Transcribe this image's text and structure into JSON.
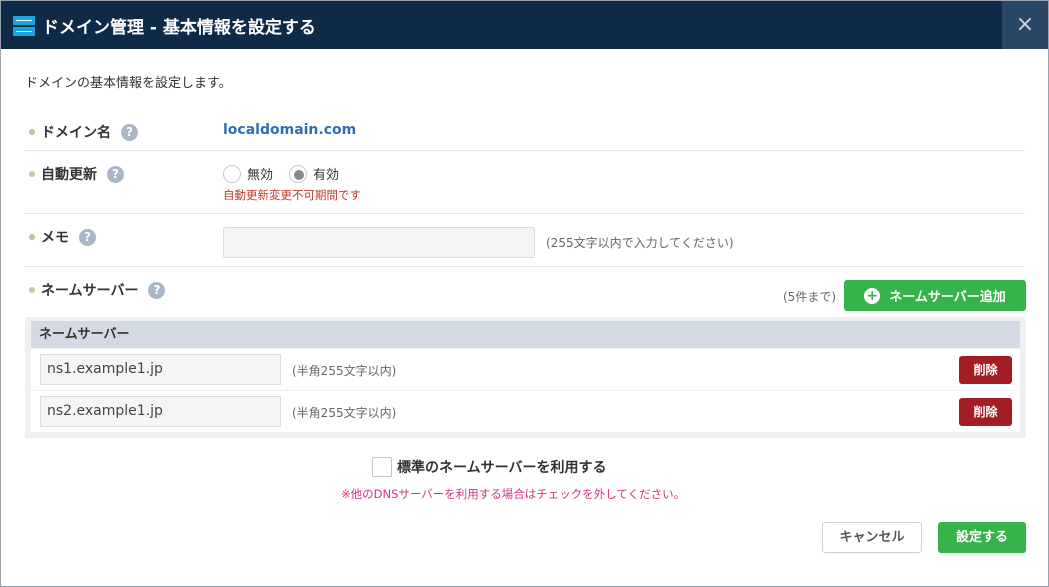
{
  "window": {
    "title": "ドメイン管理 - 基本情報を設定する",
    "close_symbol": "×"
  },
  "intro": "ドメインの基本情報を設定します。",
  "domain": {
    "label": "ドメイン名",
    "value": "localdomain.com"
  },
  "auto_renew": {
    "label": "自動更新",
    "options": [
      {
        "label": "無効",
        "selected": false
      },
      {
        "label": "有効",
        "selected": true
      }
    ],
    "warning": "自動更新変更不可期間です"
  },
  "memo": {
    "label": "メモ",
    "value": "",
    "hint": "(255文字以内で入力してください)"
  },
  "nameservers": {
    "label": "ネームサーバー",
    "limit_note": "(5件まで)",
    "add_label": "ネームサーバー追加",
    "header": "ネームサーバー",
    "rows": [
      {
        "value": "ns1.example1.jp",
        "hint": "(半角255文字以内)",
        "delete_label": "削除"
      },
      {
        "value": "ns2.example1.jp",
        "hint": "(半角255文字以内)",
        "delete_label": "削除"
      }
    ]
  },
  "standard_ns": {
    "label": "標準のネームサーバーを利用する",
    "checked": false,
    "note": "※他のDNSサーバーを利用する場合はチェックを外してください。"
  },
  "help_symbol": "?",
  "add_symbol": "+",
  "footer": {
    "cancel_label": "キャンセル",
    "submit_label": "設定する"
  },
  "colors": {
    "titlebar": "#0f2a47",
    "accent_green": "#36b44b",
    "delete_red": "#a31d24",
    "link_blue": "#2f6db5",
    "warning_red": "#c0392b",
    "note_pink": "#d63384"
  }
}
